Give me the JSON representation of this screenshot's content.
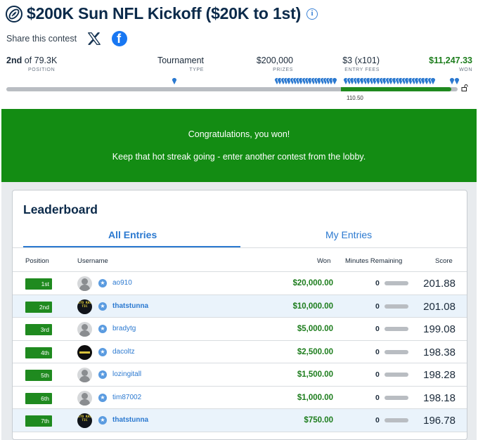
{
  "contest": {
    "title": "$200K Sun NFL Kickoff ($20K to 1st)",
    "info_symbol": "i"
  },
  "share": {
    "label": "Share this contest"
  },
  "stats": {
    "position_value": "2nd",
    "position_of": "of 79.3K",
    "position_label": "POSITION",
    "type_value": "Tournament",
    "type_label": "TYPE",
    "prizes_value": "$200,000",
    "prizes_label": "PRIZES",
    "entry_value": "$3 (x101)",
    "entry_label": "ENTRY FEES",
    "won_value": "$11,247.33",
    "won_label": "WON"
  },
  "progress": {
    "marker_label": "110.50"
  },
  "banner": {
    "line1": "Congratulations, you won!",
    "line2": "Keep that hot streak going - enter another contest from the lobby."
  },
  "leaderboard": {
    "title": "Leaderboard",
    "tabs": [
      {
        "label": "All Entries",
        "active": true
      },
      {
        "label": "My Entries",
        "active": false
      }
    ],
    "columns": {
      "position": "Position",
      "username": "Username",
      "won": "Won",
      "minutes": "Minutes Remaining",
      "score": "Score"
    },
    "rows": [
      {
        "position": "1st",
        "username": "ao910",
        "won": "$20,000.00",
        "minutes": "0",
        "score": "201.88"
      },
      {
        "position": "2nd",
        "username": "thatstunna",
        "won": "$10,000.00",
        "minutes": "0",
        "score": "201.08"
      },
      {
        "position": "3rd",
        "username": "bradytg",
        "won": "$5,000.00",
        "minutes": "0",
        "score": "199.08"
      },
      {
        "position": "4th",
        "username": "dacoltz",
        "won": "$2,500.00",
        "minutes": "0",
        "score": "198.38"
      },
      {
        "position": "5th",
        "username": "lozingitall",
        "won": "$1,500.00",
        "minutes": "0",
        "score": "198.28"
      },
      {
        "position": "6th",
        "username": "tim87002",
        "won": "$1,000.00",
        "minutes": "0",
        "score": "198.18"
      },
      {
        "position": "7th",
        "username": "thatstunna",
        "won": "$750.00",
        "minutes": "0",
        "score": "196.78"
      }
    ]
  },
  "avatar_text": "STO KAS TIC",
  "colors": {
    "brand_navy": "#0b2a4a",
    "accent_blue": "#2b79d0",
    "win_green": "#138c13"
  }
}
